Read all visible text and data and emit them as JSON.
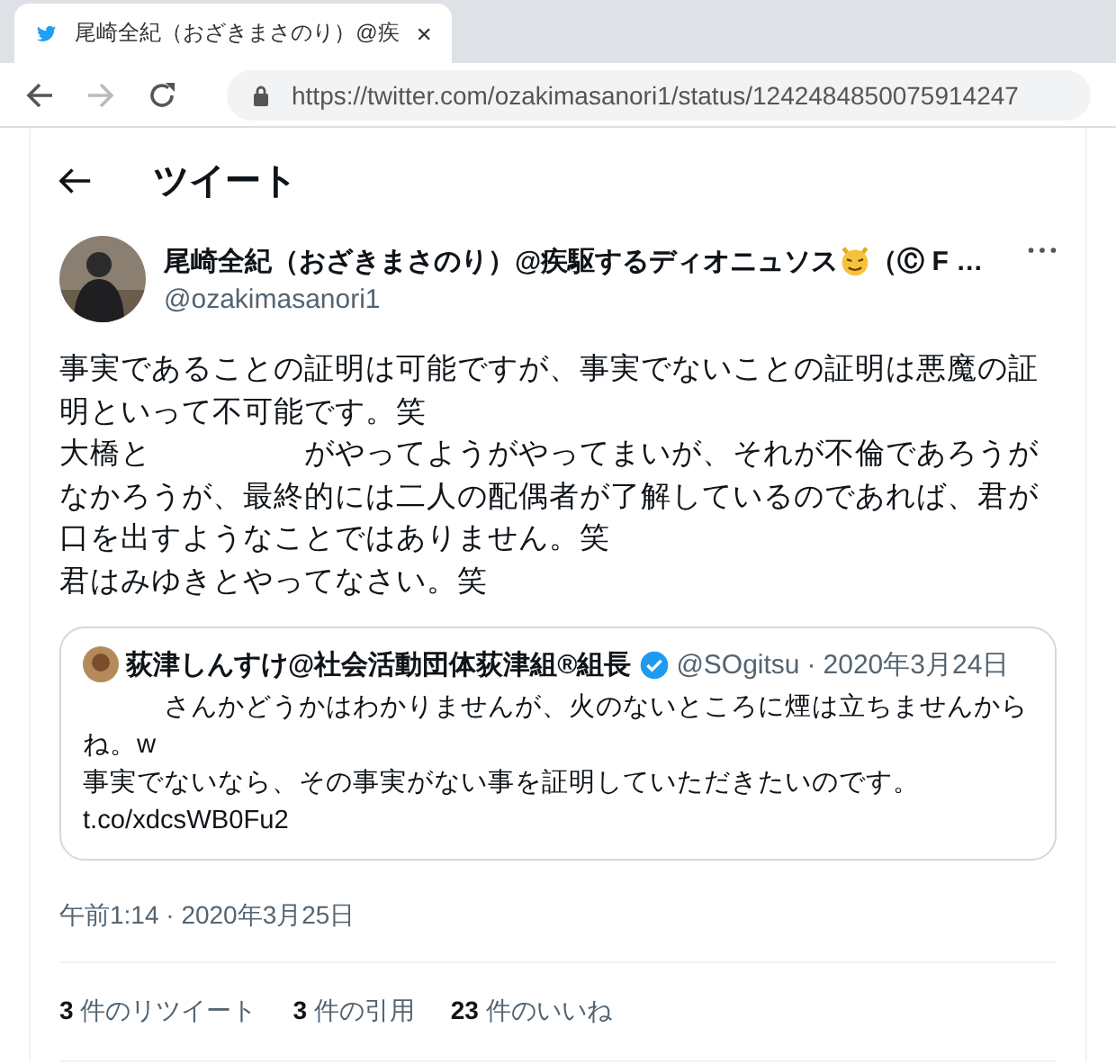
{
  "browser": {
    "tab": {
      "title": "尾崎全紀（おざきまさのり）@疾",
      "selected": true
    },
    "url": "https://twitter.com/ozakimasanori1/status/1242484850075914247"
  },
  "header": {
    "title": "ツイート"
  },
  "tweet": {
    "name": "尾崎全紀（おざきまさのり）@疾駆するディオニュソス",
    "name_suffix": "（Ⓒ F …",
    "handle": "@ozakimasanori1",
    "lines": [
      "事実であることの証明は可能ですが、事実でないことの証明は悪魔の証明といって不可能です。笑",
      "大橋と　　　　　がやってようがやってまいが、それが不倫であろうがなかろうが、最終的には二人の配偶者が了解しているのであれば、君が口を出すようなことではありません。笑",
      "君はみゆきとやってなさい。笑"
    ],
    "quote": {
      "name": "荻津しんすけ@社会活動団体荻津組®組長",
      "verified": true,
      "handle": "@SOgitsu",
      "separator": "·",
      "date": "2020年3月24日",
      "lines": [
        "　　　さんかどうかはわかりませんが、火のないところに煙は立ちませんからね。w",
        "事実でないなら、その事実がない事を証明していただきたいのです。"
      ],
      "link": "t.co/xdcsWB0Fu2"
    },
    "timestamp": "午前1:14 · 2020年3月25日",
    "stats": [
      {
        "count": "3",
        "label": "件のリツイート"
      },
      {
        "count": "3",
        "label": "件の引用"
      },
      {
        "count": "23",
        "label": "件のいいね"
      }
    ]
  }
}
